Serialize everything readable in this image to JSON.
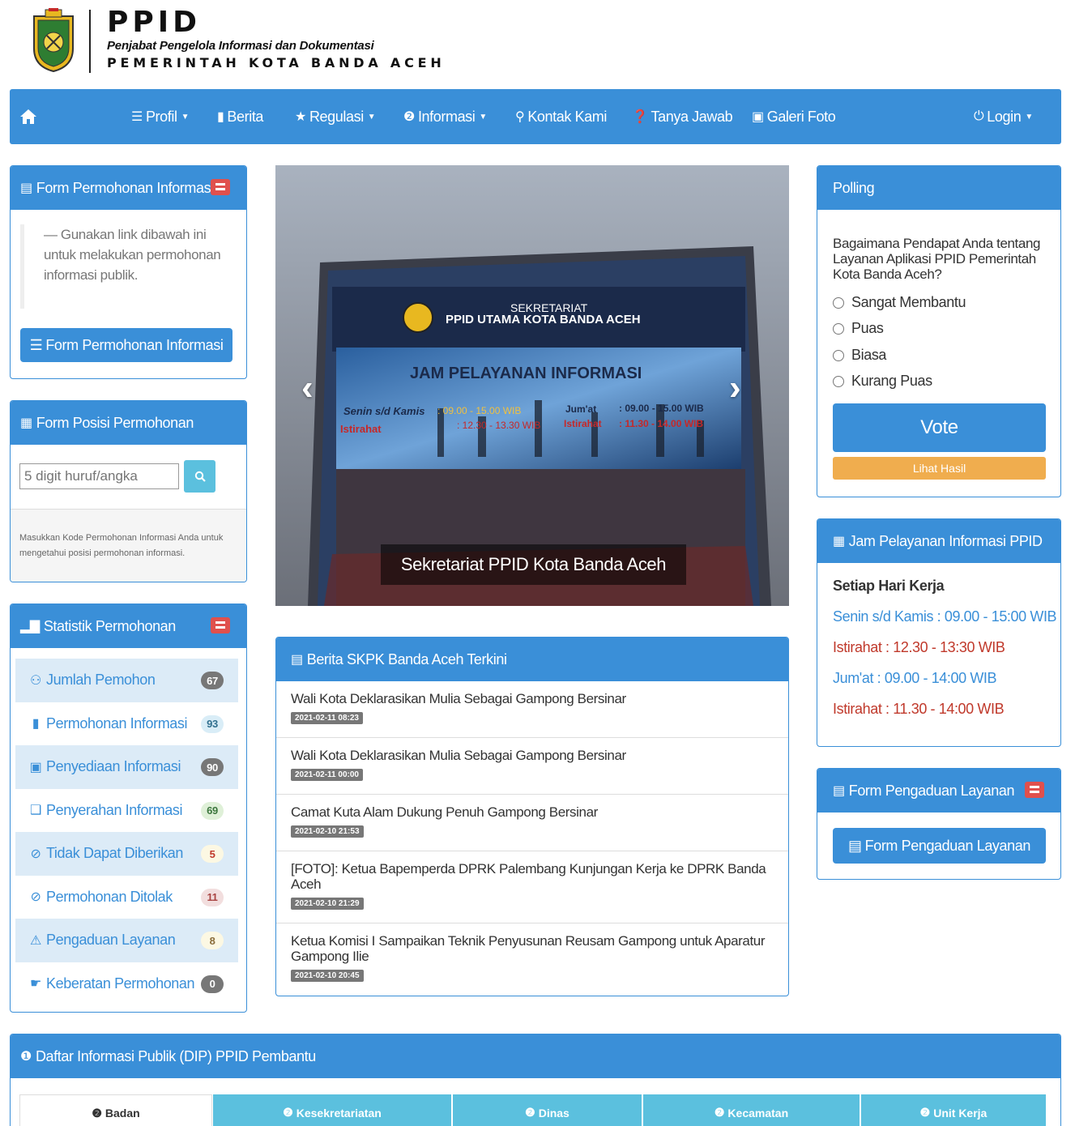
{
  "header": {
    "title": "PPID",
    "subtitle": "Penjabat Pengelola Informasi dan Dokumentasi",
    "government": "PEMERINTAH KOTA BANDA ACEH",
    "logo_icon": "banda-aceh-crest"
  },
  "nav": {
    "home_icon": "home-icon",
    "items": [
      {
        "label": "Profil",
        "icon": "list-icon",
        "dropdown": true
      },
      {
        "label": "Berita",
        "icon": "comment-icon",
        "dropdown": false
      },
      {
        "label": "Regulasi",
        "icon": "star-icon",
        "dropdown": true
      },
      {
        "label": "Informasi",
        "icon": "info-icon",
        "dropdown": true
      },
      {
        "label": "Kontak Kami",
        "icon": "map-marker-icon",
        "dropdown": false
      },
      {
        "label": "Tanya Jawab",
        "icon": "question-icon",
        "dropdown": false
      },
      {
        "label": "Galeri Foto",
        "icon": "picture-icon",
        "dropdown": false
      },
      {
        "label": "Login",
        "icon": "power-icon",
        "dropdown": true
      }
    ]
  },
  "form_permohonan": {
    "title": "Form Permohonan Informasi",
    "note": "— Gunakan link dibawah ini untuk melakukan permohonan informasi publik.",
    "button": "Form Permohonan Informasi"
  },
  "form_posisi": {
    "title": "Form Posisi Permohonan",
    "placeholder": "5 digit huruf/angka",
    "help": "Masukkan Kode Permohonan Informasi Anda untuk mengetahui posisi permohonan informasi."
  },
  "statistik": {
    "title": "Statistik Permohonan",
    "items": [
      {
        "label": "Jumlah Pemohon",
        "count": "67",
        "icon": "user-icon",
        "badge_bg": "#777777",
        "badge_fg": "#ffffff"
      },
      {
        "label": "Permohonan Informasi",
        "count": "93",
        "icon": "file-icon",
        "badge_bg": "#d9edf7",
        "badge_fg": "#31708f"
      },
      {
        "label": "Penyediaan Informasi",
        "count": "90",
        "icon": "hdd-icon",
        "badge_bg": "#777777",
        "badge_fg": "#ffffff"
      },
      {
        "label": "Penyerahan Informasi",
        "count": "69",
        "icon": "gift-icon",
        "badge_bg": "#dff0d8",
        "badge_fg": "#3c763d"
      },
      {
        "label": "Tidak Dapat Diberikan",
        "count": "5",
        "icon": "ban-icon",
        "badge_bg": "#fcf8e3",
        "badge_fg": "#c0392b"
      },
      {
        "label": "Permohonan Ditolak",
        "count": "11",
        "icon": "ban-icon",
        "badge_bg": "#f2dede",
        "badge_fg": "#a94442"
      },
      {
        "label": "Pengaduan Layanan",
        "count": "8",
        "icon": "warning-icon",
        "badge_bg": "#fcf8e3",
        "badge_fg": "#8a6d3b"
      },
      {
        "label": "Keberatan Permohonan",
        "count": "0",
        "icon": "thumbs-down-icon",
        "badge_bg": "#777777",
        "badge_fg": "#ffffff"
      }
    ]
  },
  "carousel": {
    "caption": "Sekretariat PPID Kota Banda Aceh",
    "sign_line1": "SEKRETARIAT",
    "sign_line2": "PPID UTAMA KOTA BANDA ACEH",
    "sign_heading": "JAM PELAYANAN INFORMASI",
    "sign_days1": "Senin s/d Kamis",
    "sign_hours1": ": 09.00 - 15.00 WIB",
    "sign_days2": "Jum'at",
    "sign_hours2": ": 09.00 - 15.00 WIB",
    "sign_break_label": "Istirahat",
    "sign_break1": ": 12.30 - 13.30 WIB",
    "sign_break2_label": "Istirahat",
    "sign_break2": ": 11.30 - 14.00 WIB"
  },
  "berita": {
    "title": "Berita SKPK Banda Aceh Terkini",
    "items": [
      {
        "title": "Wali Kota Deklarasikan Mulia Sebagai Gampong Bersinar",
        "date": "2021-02-11 08:23"
      },
      {
        "title": "Wali Kota Deklarasikan Mulia Sebagai Gampong Bersinar",
        "date": "2021-02-11 00:00"
      },
      {
        "title": "Camat Kuta Alam Dukung Penuh Gampong Bersinar",
        "date": "2021-02-10 21:53"
      },
      {
        "title": "[FOTO]: Ketua Bapemperda DPRK Palembang Kunjungan Kerja ke DPRK Banda Aceh",
        "date": "2021-02-10 21:29"
      },
      {
        "title": "Ketua Komisi I Sampaikan Teknik Penyusunan Reusam Gampong untuk Aparatur Gampong Ilie",
        "date": "2021-02-10 20:45"
      }
    ]
  },
  "polling": {
    "title": "Polling",
    "question": "Bagaimana Pendapat Anda tentang Layanan Aplikasi PPID Pemerintah Kota Banda Aceh?",
    "options": [
      "Sangat Membantu",
      "Puas",
      "Biasa",
      "Kurang Puas"
    ],
    "vote": "Vote",
    "results": "Lihat Hasil"
  },
  "jam": {
    "title": "Jam Pelayanan Informasi PPID",
    "heading": "Setiap Hari Kerja",
    "line1": "Senin s/d Kamis : 09.00 - 15:00 WIB",
    "line2": "Istirahat : 12.30 - 13:30 WIB",
    "line3": "Jum'at : 09.00 - 14:00 WIB",
    "line4": "Istirahat : 11.30 - 14:00 WIB",
    "blue": "#3a8fd8",
    "red": "#c0392b"
  },
  "pengaduan": {
    "title": "Form Pengaduan Layanan",
    "button": "Form Pengaduan Layanan"
  },
  "dip": {
    "title": "Daftar Informasi Publik (DIP) PPID Pembantu",
    "tabs": [
      "Badan",
      "Kesekretariatan",
      "Dinas",
      "Kecamatan",
      "Unit Kerja"
    ]
  },
  "colors": {
    "primary": "#3a8fd8",
    "danger": "#e0504d",
    "warning": "#f0ad4e",
    "info": "#5bc0de"
  }
}
